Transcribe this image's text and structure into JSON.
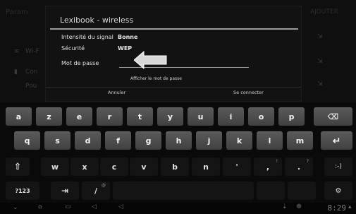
{
  "dialog": {
    "title": "Lexibook - wireless",
    "signal_label": "Intensité du signal",
    "signal_value": "Bonne",
    "security_label": "Sécurité",
    "security_value": "WEP",
    "password_label": "Mot de passe",
    "password_value": "",
    "show_password": "Afficher le mot de passe",
    "cancel": "Annuler",
    "connect": "Se connecter"
  },
  "keyboard": {
    "row1": [
      "a",
      "z",
      "e",
      "r",
      "t",
      "y",
      "u",
      "i",
      "o",
      "p"
    ],
    "row2": [
      "q",
      "s",
      "d",
      "f",
      "g",
      "h",
      "j",
      "k",
      "l",
      "m"
    ],
    "row3": [
      "w",
      "x",
      "c",
      "v",
      "b",
      "n",
      "'",
      ",",
      "."
    ],
    "row3_subs": [
      "",
      "",
      "",
      "",
      "",
      "",
      "",
      "!",
      "?"
    ],
    "row4_left": "?123",
    "tab_key": "⇥",
    "slash": "/",
    "slash_sub": "@",
    "smiley": ":-)",
    "backspace": "⌫",
    "enter": "↵",
    "shift": "⇧",
    "settings": "⚙"
  },
  "status": {
    "time": "8:29"
  },
  "icons": {
    "back": "back-icon",
    "home": "home-icon",
    "recents": "recents-icon"
  }
}
